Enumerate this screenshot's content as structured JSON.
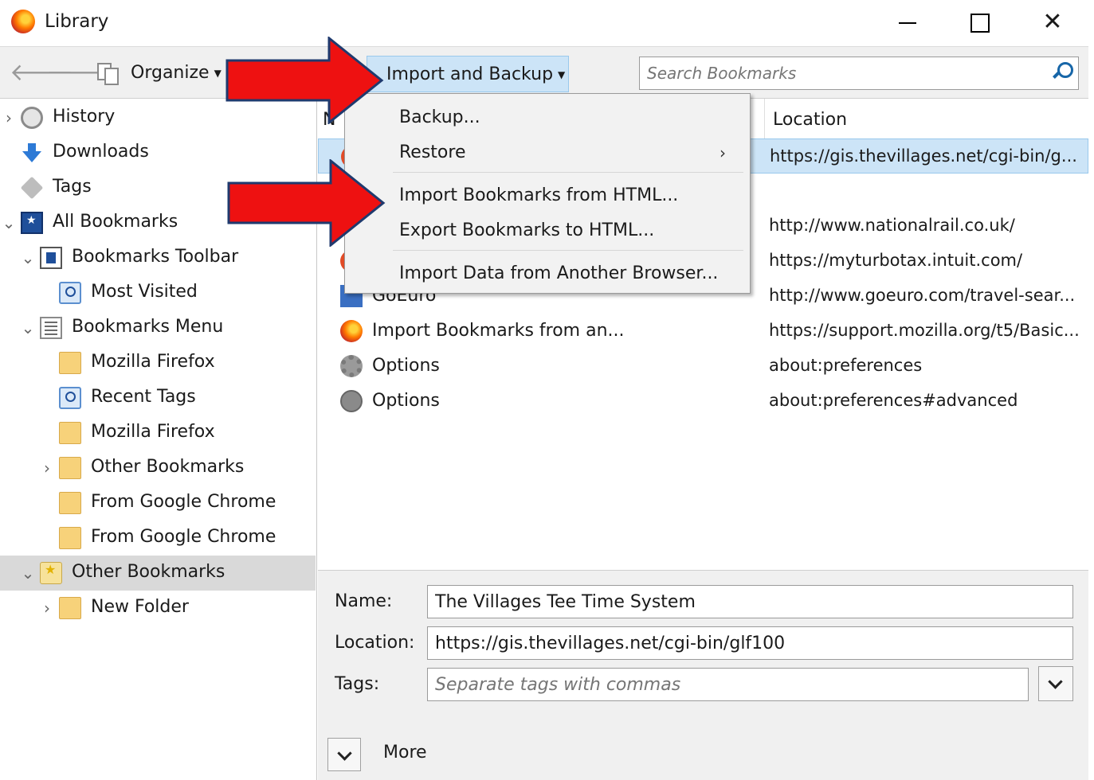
{
  "window": {
    "title": "Library",
    "minimize_label": "—",
    "maximize_label": "",
    "close_label": "✕"
  },
  "toolbar": {
    "back_label": "🡐",
    "forward_label": "🡒",
    "organize_label": "Organize",
    "import_backup_label": "Import and Backup",
    "search_placeholder": "Search Bookmarks"
  },
  "sidebar": {
    "items": [
      {
        "label": "History",
        "expander": "›"
      },
      {
        "label": "Downloads",
        "expander": ""
      },
      {
        "label": "Tags",
        "expander": ""
      },
      {
        "label": "All Bookmarks",
        "expander": "⌄"
      },
      {
        "label": "Bookmarks Toolbar",
        "expander": "⌄"
      },
      {
        "label": "Most Visited",
        "expander": ""
      },
      {
        "label": "Bookmarks Menu",
        "expander": "⌄"
      },
      {
        "label": "Mozilla Firefox",
        "expander": ""
      },
      {
        "label": "Recent Tags",
        "expander": ""
      },
      {
        "label": "Mozilla Firefox",
        "expander": ""
      },
      {
        "label": "Other Bookmarks",
        "expander": "›"
      },
      {
        "label": "From Google Chrome",
        "expander": ""
      },
      {
        "label": "From Google Chrome",
        "expander": ""
      },
      {
        "label": "Other Bookmarks",
        "expander": "⌄"
      },
      {
        "label": "New Folder",
        "expander": "›"
      }
    ]
  },
  "list": {
    "col_name": "N",
    "col_location": "Location",
    "rows": [
      {
        "name": "",
        "location": "https://gis.thevillages.net/cgi-bin/g..."
      },
      {
        "name": "",
        "location": ""
      },
      {
        "name": "",
        "location": "http://www.nationalrail.co.uk/"
      },
      {
        "name": "",
        "location": "https://myturbotax.intuit.com/"
      },
      {
        "name": "GoEuro",
        "location": "http://www.goeuro.com/travel-sear..."
      },
      {
        "name": "Import Bookmarks from an...",
        "location": "https://support.mozilla.org/t5/Basic..."
      },
      {
        "name": "Options",
        "location": "about:preferences"
      },
      {
        "name": "Options",
        "location": "about:preferences#advanced"
      }
    ]
  },
  "menu": {
    "items": [
      {
        "label": "Backup..."
      },
      {
        "label": "Restore",
        "submenu": "›"
      },
      {
        "label": "Import Bookmarks from HTML..."
      },
      {
        "label": "Export Bookmarks to HTML..."
      },
      {
        "label": "Import Data from Another Browser..."
      }
    ]
  },
  "details": {
    "name_label": "Name:",
    "name_value": "The Villages Tee Time System",
    "location_label": "Location:",
    "location_value": "https://gis.thevillages.net/cgi-bin/glf100",
    "tags_label": "Tags:",
    "tags_placeholder": "Separate tags with commas",
    "more_label": "More"
  },
  "colors": {
    "selection": "#cce4f7",
    "arrow": "#ee1111",
    "arrow_border": "#1f3a6e"
  }
}
